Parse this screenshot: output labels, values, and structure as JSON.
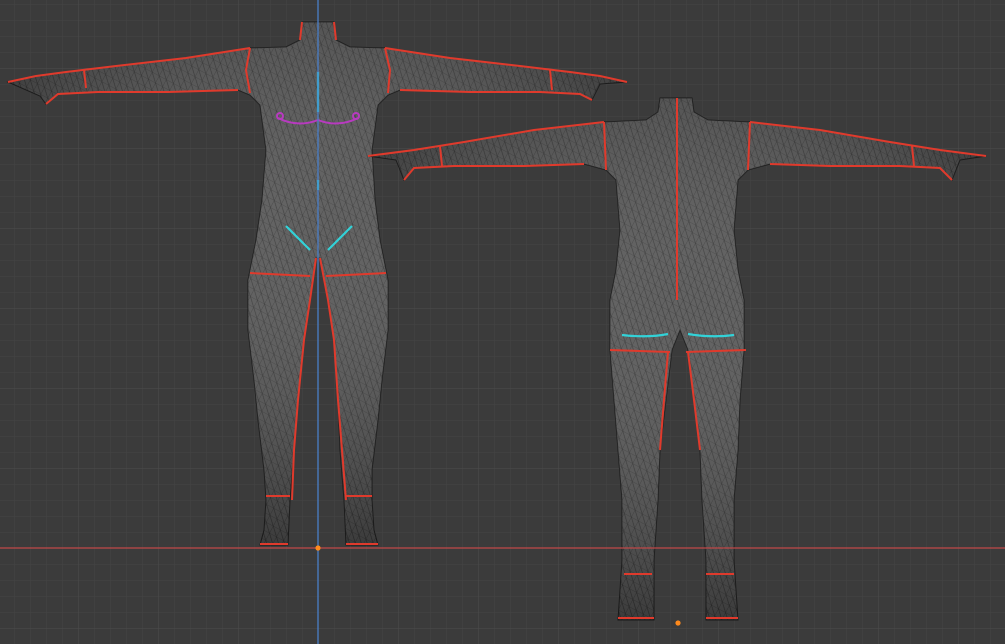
{
  "viewport": {
    "view": "front-ortho-3d-viewport",
    "background_color": "#3b3b3b",
    "grid_minor_color": "#444444",
    "grid_major_color": "#4c4c4c",
    "x_axis_color": "#c04848",
    "z_axis_color": "#4a7fc8",
    "wire_color": "#0e0e0e",
    "mesh_fill": "#525252",
    "mesh_shade": "#3a3a3a",
    "seam_color": "#e03a2c",
    "pin_color": "#32d2d8",
    "selected_edge_color": "#b83ac0",
    "origin_color": "#ff8a1c"
  },
  "objects": [
    {
      "name": "body-front-mesh",
      "view": "front"
    },
    {
      "name": "body-back-mesh",
      "view": "back"
    }
  ]
}
